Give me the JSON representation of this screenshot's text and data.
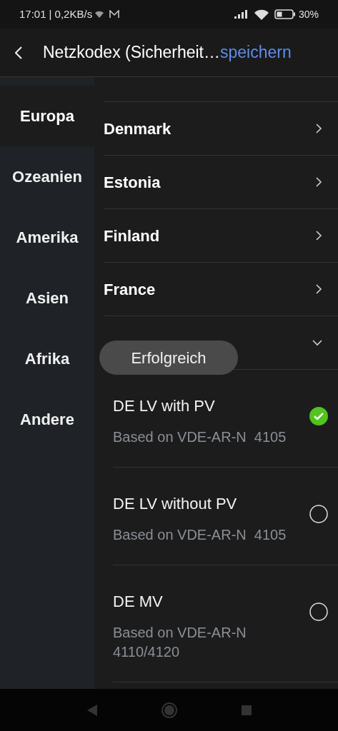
{
  "status_bar": {
    "time": "17:01",
    "speed": "| 0,2KB/s",
    "battery": "30%"
  },
  "header": {
    "title": "Netzkodex (Sicherheit…",
    "action": "speichern"
  },
  "sidebar": {
    "items": [
      {
        "label": "Europa",
        "selected": true
      },
      {
        "label": "Ozeanien",
        "selected": false
      },
      {
        "label": "Amerika",
        "selected": false
      },
      {
        "label": "Asien",
        "selected": false
      },
      {
        "label": "Afrika",
        "selected": false
      },
      {
        "label": "Andere",
        "selected": false
      }
    ]
  },
  "countries": [
    {
      "name": "Denmark",
      "expanded": false
    },
    {
      "name": "Estonia",
      "expanded": false
    },
    {
      "name": "Finland",
      "expanded": false
    },
    {
      "name": "France",
      "expanded": false
    },
    {
      "expanded": true
    }
  ],
  "codes": [
    {
      "name": "DE LV with PV",
      "description": "Based on VDE-AR-N  4105",
      "selected": true
    },
    {
      "name": "DE LV without PV",
      "description": "Based on VDE-AR-N  4105",
      "selected": false
    },
    {
      "name": "DE MV",
      "description": "Based on VDE-AR-N 4110/4120",
      "selected": false
    }
  ],
  "toast": "Erfolgreich"
}
